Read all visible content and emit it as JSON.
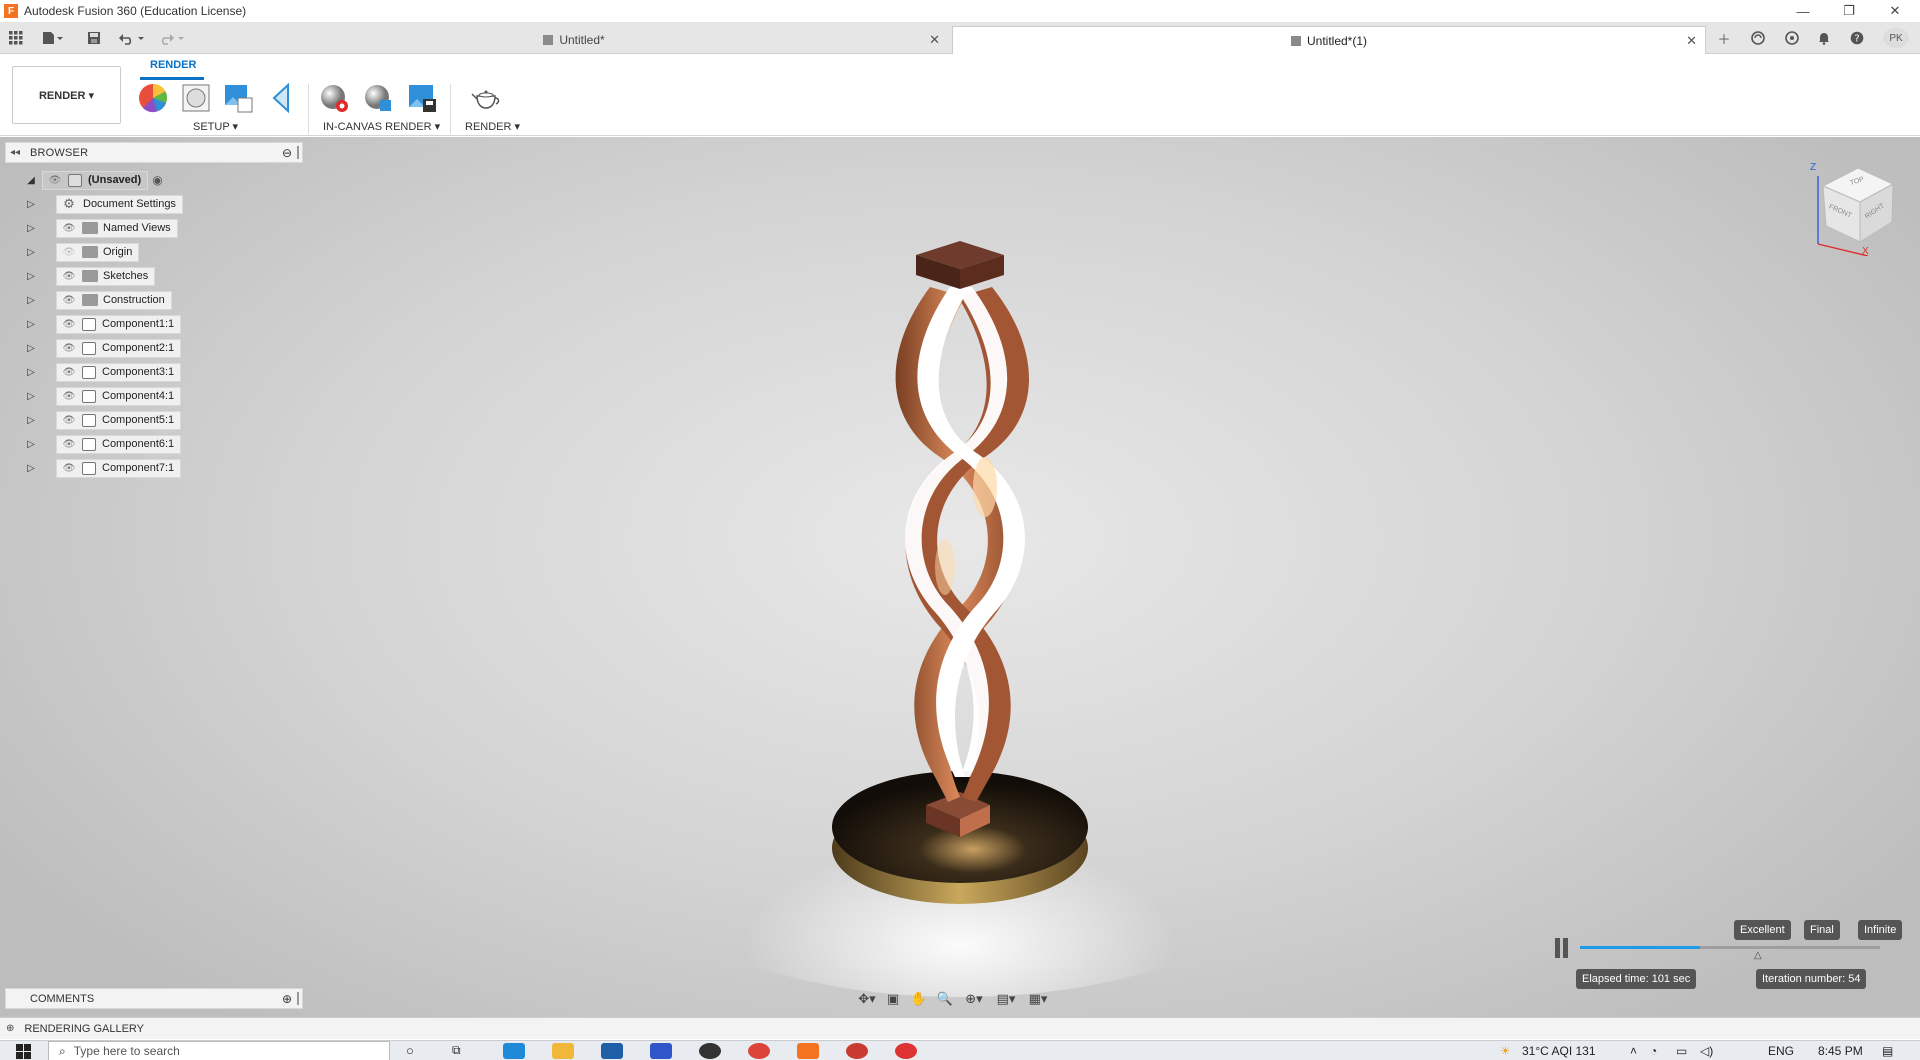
{
  "window": {
    "title": "Autodesk Fusion 360 (Education License)",
    "app_icon_letter": "F",
    "minimize": "—",
    "restore": "❐",
    "close": "✕"
  },
  "tabs": [
    {
      "label": "Untitled*",
      "active": false
    },
    {
      "label": "Untitled*(1)",
      "active": true
    }
  ],
  "user_initials": "PK",
  "ribbon": {
    "workspace": "RENDER ▾",
    "tab": "RENDER",
    "groups": {
      "setup": "SETUP ▾",
      "in_canvas": "IN-CANVAS RENDER ▾",
      "render": "RENDER ▾"
    }
  },
  "browser": {
    "title": "BROWSER",
    "root": "(Unsaved)",
    "items": [
      {
        "label": "Document Settings",
        "icon": "gear-icon"
      },
      {
        "label": "Named Views",
        "icon": "folder-icon"
      },
      {
        "label": "Origin",
        "icon": "folder-icon",
        "hidden": true
      },
      {
        "label": "Sketches",
        "icon": "folder-icon"
      },
      {
        "label": "Construction",
        "icon": "folder-icon"
      },
      {
        "label": "Component1:1",
        "icon": "component-icon"
      },
      {
        "label": "Component2:1",
        "icon": "component-icon"
      },
      {
        "label": "Component3:1",
        "icon": "component-icon"
      },
      {
        "label": "Component4:1",
        "icon": "component-icon"
      },
      {
        "label": "Component5:1",
        "icon": "component-icon"
      },
      {
        "label": "Component6:1",
        "icon": "component-icon"
      },
      {
        "label": "Component7:1",
        "icon": "component-icon"
      }
    ]
  },
  "viewcube": {
    "top": "TOP",
    "front": "FRONT",
    "right": "RIGHT",
    "z": "Z",
    "x": "X"
  },
  "render_controls": {
    "quality_labels": [
      "Excellent",
      "Final",
      "Infinite"
    ],
    "progress": 0.4,
    "elapsed": "Elapsed time: 101 sec",
    "iteration": "Iteration number: 54",
    "colors": {
      "progress": "#1e9be8",
      "pill": "#555555"
    }
  },
  "comments": {
    "title": "COMMENTS"
  },
  "gallery": {
    "title": "RENDERING GALLERY"
  },
  "taskbar": {
    "search_placeholder": "Type here to search",
    "weather": "31°C  AQI 131",
    "lang": "ENG",
    "time": "8:45 PM"
  },
  "colors": {
    "accent": "#0a72c7",
    "copper": "#b5653a",
    "base": "#2b2116"
  }
}
